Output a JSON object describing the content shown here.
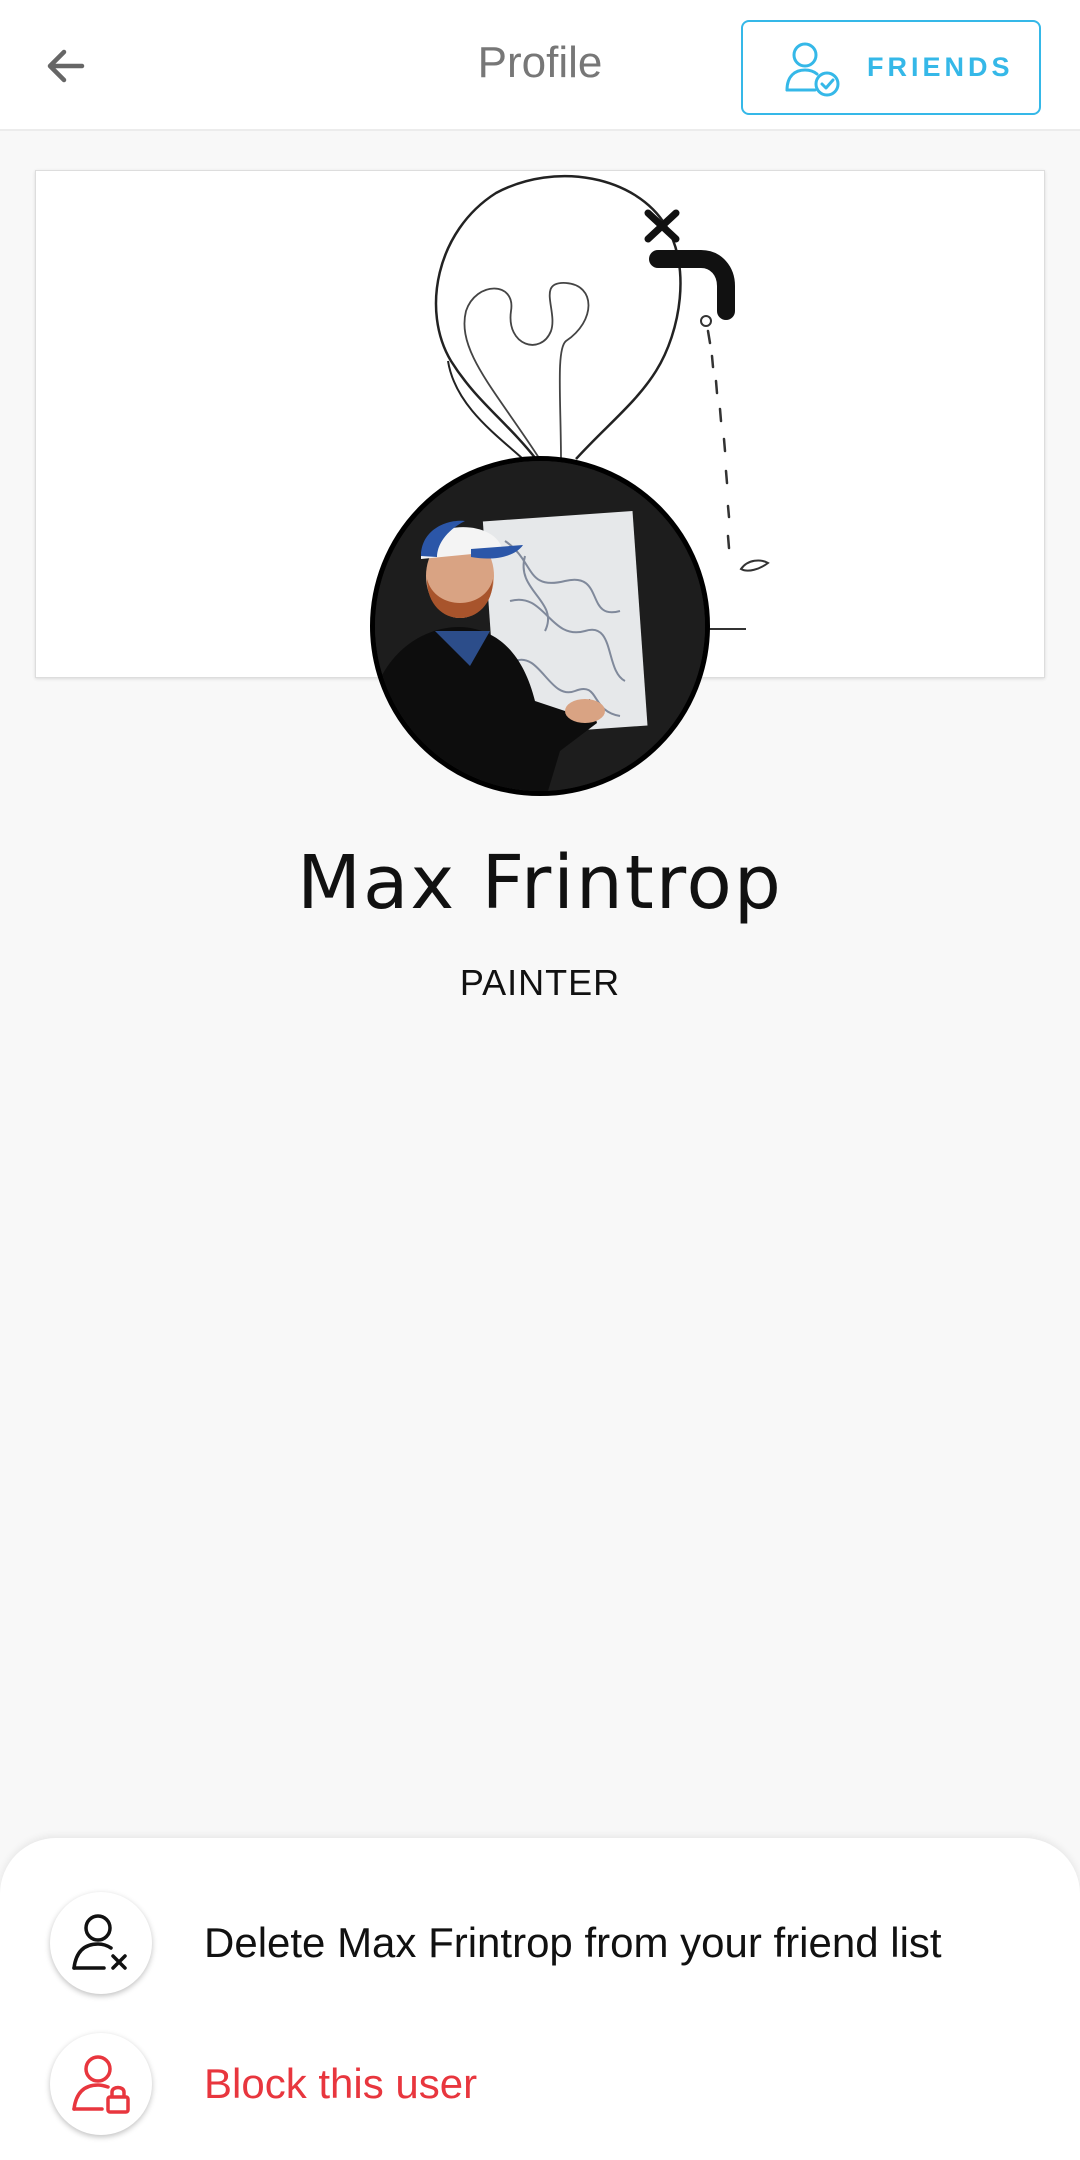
{
  "header": {
    "title": "Profile",
    "back_icon": "arrow-left-icon",
    "friends_button": {
      "label": "FRIENDS",
      "icon": "user-check-icon"
    }
  },
  "profile": {
    "name": "Max Frintrop",
    "role": "PAINTER"
  },
  "actions": [
    {
      "label": "Delete Max Frintrop from your friend list",
      "icon": "user-remove-icon"
    },
    {
      "label": "Block this user",
      "icon": "user-lock-icon",
      "color": "#e8363e"
    }
  ],
  "colors": {
    "accent": "#35b8e8",
    "danger": "#e8363e",
    "background": "#f8f8f8"
  }
}
